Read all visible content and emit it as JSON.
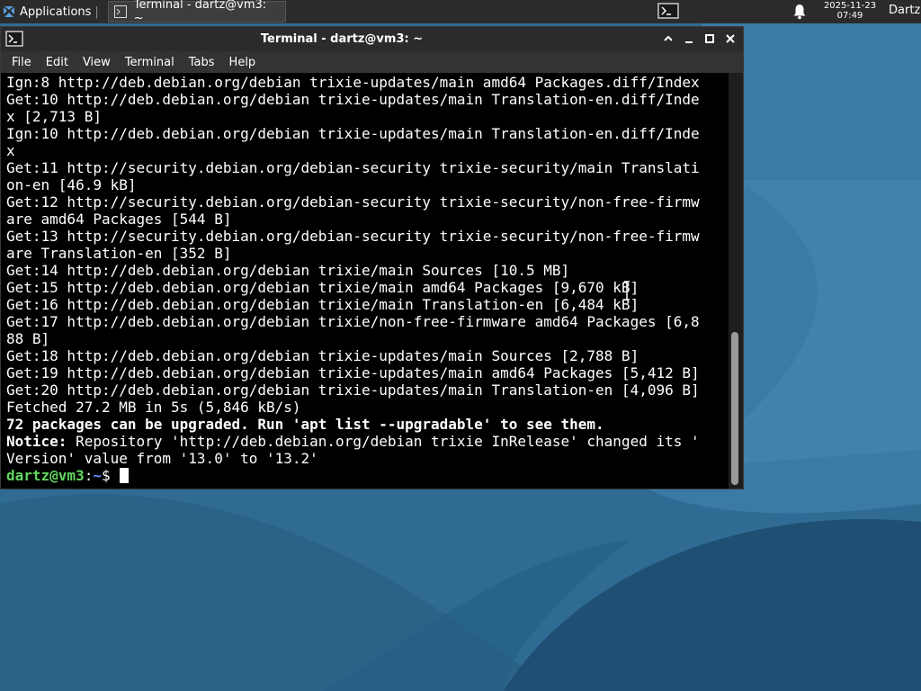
{
  "panel": {
    "applications_label": "Applications",
    "task_title": "Terminal - dartz@vm3: ~",
    "clock_date": "2025-11-23",
    "clock_time": "07:49",
    "user": "Dartz"
  },
  "window": {
    "title": "Terminal - dartz@vm3: ~",
    "menu": [
      "File",
      "Edit",
      "View",
      "Terminal",
      "Tabs",
      "Help"
    ]
  },
  "terminal": {
    "lines": [
      "Ign:8 http://deb.debian.org/debian trixie-updates/main amd64 Packages.diff/Index",
      "Get:10 http://deb.debian.org/debian trixie-updates/main Translation-en.diff/Inde",
      "x [2,713 B]",
      "Ign:10 http://deb.debian.org/debian trixie-updates/main Translation-en.diff/Inde",
      "x",
      "Get:11 http://security.debian.org/debian-security trixie-security/main Translati",
      "on-en [46.9 kB]",
      "Get:12 http://security.debian.org/debian-security trixie-security/non-free-firmw",
      "are amd64 Packages [544 B]",
      "Get:13 http://security.debian.org/debian-security trixie-security/non-free-firmw",
      "are Translation-en [352 B]",
      "Get:14 http://deb.debian.org/debian trixie/main Sources [10.5 MB]",
      "Get:15 http://deb.debian.org/debian trixie/main amd64 Packages [9,670 kB]",
      "Get:16 http://deb.debian.org/debian trixie/main Translation-en [6,484 kB]",
      "Get:17 http://deb.debian.org/debian trixie/non-free-firmware amd64 Packages [6,8",
      "88 B]",
      "Get:18 http://deb.debian.org/debian trixie-updates/main Sources [2,788 B]",
      "Get:19 http://deb.debian.org/debian trixie-updates/main amd64 Packages [5,412 B]",
      "Get:20 http://deb.debian.org/debian trixie-updates/main Translation-en [4,096 B]",
      "Fetched 27.2 MB in 5s (5,846 kB/s)"
    ],
    "upgrade_notice": "72 packages can be upgraded. Run 'apt list --upgradable' to see them.",
    "notice_label": "Notice:",
    "notice_text": " Repository 'http://deb.debian.org/debian trixie InRelease' changed its '",
    "notice_text_cont": "Version' value from '13.0' to '13.2'",
    "prompt_user": "dartz@vm3",
    "prompt_sep": ":",
    "prompt_path": "~",
    "prompt_symbol": "$ "
  },
  "colors": {
    "prompt_user": "#5fd75f",
    "prompt_path": "#6b8cff",
    "panel_bg": "#2b2b2b",
    "terminal_bg": "#000000"
  },
  "icons": {
    "apps": "xfce-mouse-icon",
    "task": "terminal-icon",
    "notifications": "bell-icon"
  }
}
